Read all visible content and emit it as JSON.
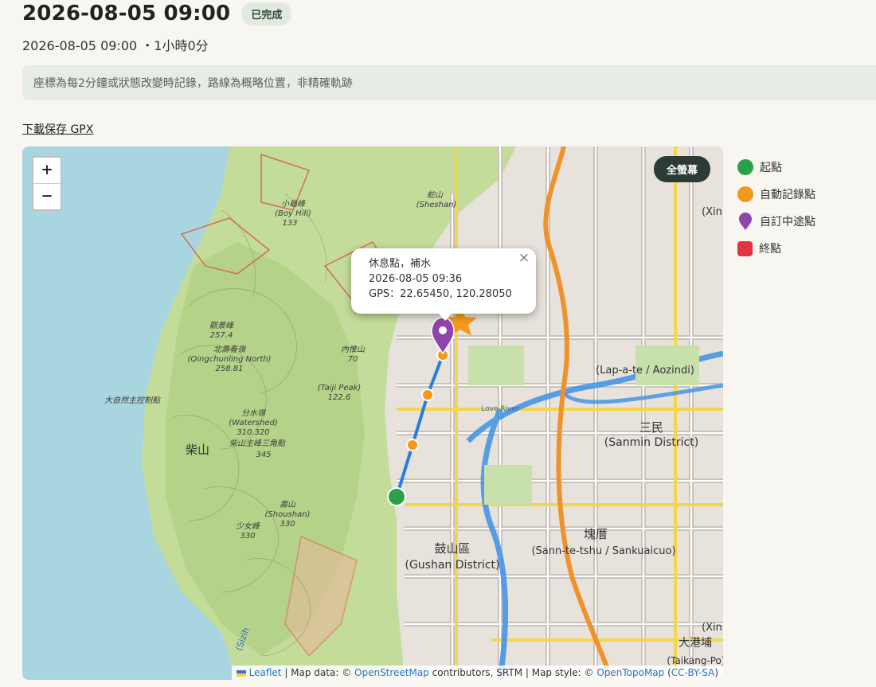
{
  "header": {
    "title": "2026-08-05 09:00",
    "status_badge": "已完成"
  },
  "summary": {
    "text": "2026-08-05 09:00 ・1小時0分"
  },
  "notice": {
    "text": "座標為每2分鐘或狀態改變時記錄，路線為概略位置，非精確軌跡"
  },
  "download": {
    "label": "下載保存 GPX"
  },
  "map": {
    "zoom_in_label": "+",
    "zoom_out_label": "−",
    "fullscreen_label": "全螢幕",
    "popup": {
      "name": "休息點，補水",
      "time": "2026-08-05 09:36",
      "gps": "GPS：22.65450, 120.28050",
      "close_label": "×"
    },
    "attribution": {
      "leaflet": "Leaflet",
      "text1": " | Map data: © ",
      "osm": "OpenStreetMap",
      "text2": " contributors, SRTM | Map style: © ",
      "otm": "OpenTopoMap",
      "text3": " (",
      "license": "CC-BY-SA",
      "text4": ")"
    },
    "labels": {
      "boy_hill": "小龜峰",
      "boy_hill_en": "(Boy Hill)",
      "boy_hill_h": "133",
      "sheshan": "蛇山",
      "sheshan_en": "(Sheshan)",
      "guanyin": "觀景峰",
      "guanyin_h": "257.4",
      "qingchunling": "北壽春嶺",
      "qingchunling_en": "(Qingchunling North)",
      "qingchunling_h": "258.81",
      "taiji": "(Taiji Peak)",
      "taiji_h": "122.6",
      "neiwei": "內惟山",
      "neiwei_h": "70",
      "control": "大自然主控制點",
      "chaishan": "柴山",
      "watershed": "分水嶺",
      "watershed_en": "(Watershed)",
      "watershed_h": "310.320",
      "chaishan3": "柴山主峰三角點",
      "chaishan3_h": "345",
      "shoushan": "壽山",
      "shoushan_en": "(Shoushan)",
      "shoushan_h": "330",
      "shaonu": "少女峰",
      "shaonu_h": "330",
      "gushan": "鼓山區",
      "gushan_en": "(Gushan District)",
      "sanmin": "三民",
      "sanmin_en": "(Sanmin District)",
      "lapate": "(Lap-a-te / Aozindi)",
      "sannteshu": "(Sann-te-tshu / Sankuaicuo)",
      "kuaicuo": "塊厝",
      "dagangpu": "大港埔",
      "taikang": "(Taikang-Po)",
      "xin_top": "(Xin",
      "xin_bottom": "(Xin",
      "aihe": "Love River",
      "sizih": "(Sizih"
    }
  },
  "legend": [
    {
      "label": "起點",
      "color": "#2aa04a",
      "shape": "circle"
    },
    {
      "label": "自動記錄點",
      "color": "#f39a1c",
      "shape": "circle"
    },
    {
      "label": "自訂中途點",
      "color": "#8e44ad",
      "shape": "pin"
    },
    {
      "label": "終點",
      "color": "#e0353f",
      "shape": "square"
    }
  ],
  "route_colors": {
    "line": "#2a7de0",
    "start": "#2aa04a",
    "auto": "#f39a1c",
    "waypoint": "#8e44ad",
    "end": "#f39a1c"
  }
}
